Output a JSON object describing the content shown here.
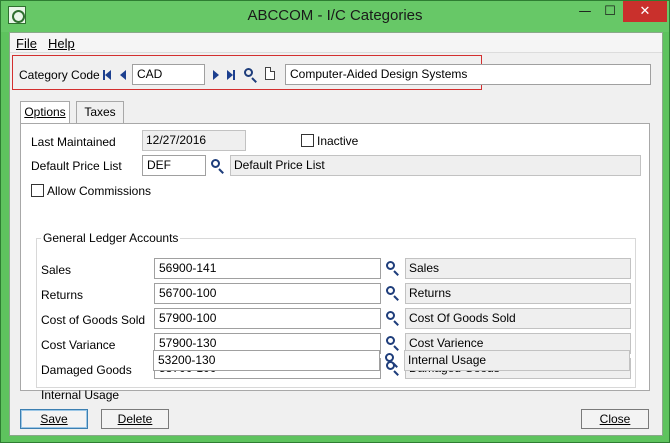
{
  "window": {
    "title": "ABCCOM - I/C Categories",
    "min_symbol": "—",
    "max_symbol": "☐",
    "close_symbol": "✕"
  },
  "menu": {
    "file": "File",
    "help": "Help"
  },
  "category": {
    "label": "Category Code",
    "code": "CAD",
    "description": "Computer-Aided Design Systems"
  },
  "tabs": [
    {
      "label": "Options"
    },
    {
      "label": "Taxes"
    }
  ],
  "options": {
    "last_maintained_label": "Last Maintained",
    "last_maintained_value": "12/27/2016",
    "inactive_label": "Inactive",
    "default_price_list_label": "Default Price List",
    "default_price_list_value": "DEF",
    "default_price_list_desc": "Default Price List",
    "allow_commissions_label": "Allow Commissions"
  },
  "gl": {
    "title": "General Ledger Accounts",
    "rows": [
      {
        "label": "Sales",
        "account": "56900-141",
        "desc": "Sales"
      },
      {
        "label": "Returns",
        "account": "56700-100",
        "desc": "Returns"
      },
      {
        "label": "Cost of Goods Sold",
        "account": "57900-100",
        "desc": "Cost Of Goods Sold"
      },
      {
        "label": "Cost Variance",
        "account": "57900-130",
        "desc": "Cost Varience"
      },
      {
        "label": "Damaged Goods",
        "account": "58700-100",
        "desc": "Damaged Goods"
      },
      {
        "label": "Internal Usage",
        "account": "53200-130",
        "desc": "Internal Usage"
      }
    ]
  },
  "buttons": {
    "save": "Save",
    "delete": "Delete",
    "close": "Close"
  }
}
